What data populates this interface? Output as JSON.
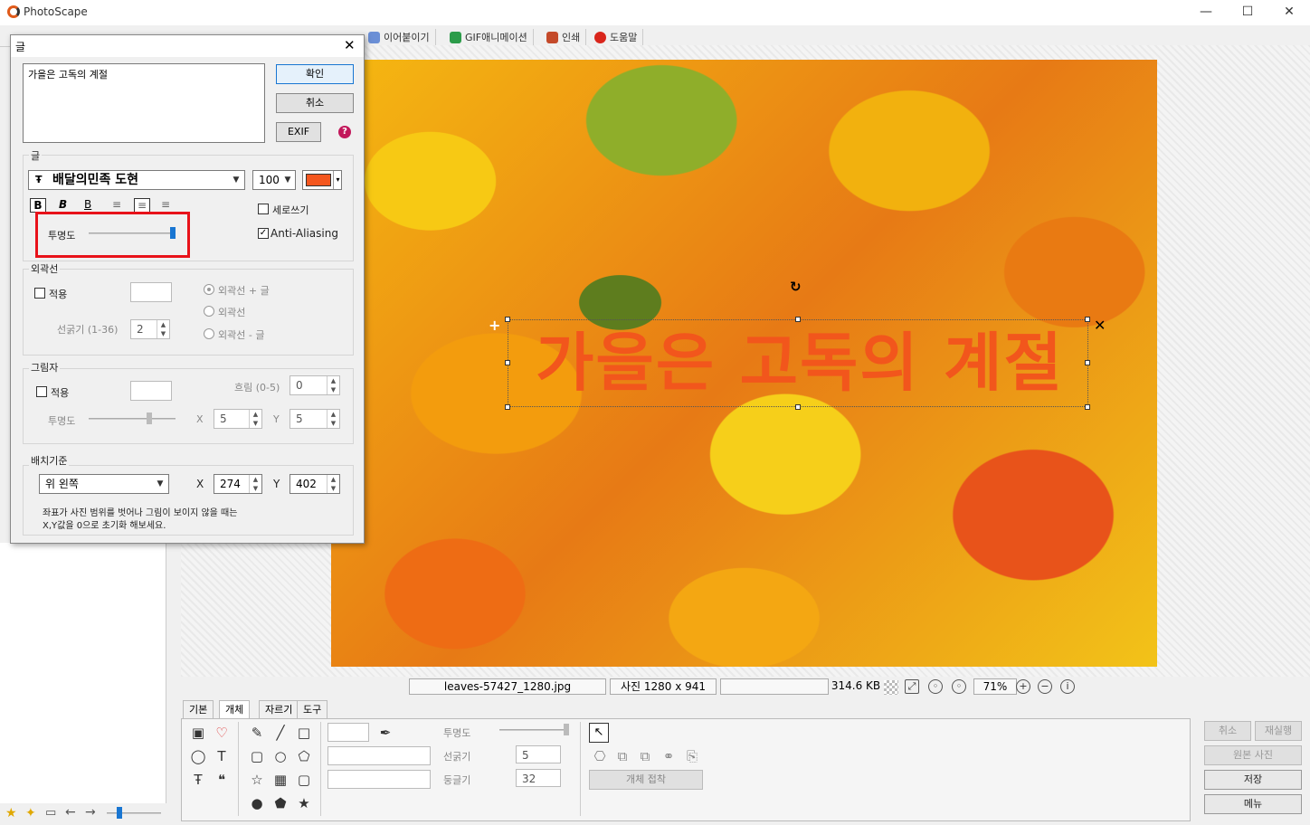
{
  "app": {
    "title": "PhotoScape"
  },
  "window_controls": {
    "minimize": "—",
    "maximize": "☐",
    "close": "✕"
  },
  "tabs": [
    {
      "label": "이어붙이기"
    },
    {
      "label": "GIF애니메이션"
    },
    {
      "label": "인쇄"
    },
    {
      "label": "도움말"
    }
  ],
  "photo": {
    "text_overlay": "가을은 고독의 계절",
    "accent": "#f2561c"
  },
  "status": {
    "filename": "leaves-57427_1280.jpg",
    "dimensions": "사진 1280 x 941",
    "filesize": "314.6 KB",
    "zoom": "71%"
  },
  "bottom_tabs": [
    {
      "label": "기본"
    },
    {
      "label": "개체"
    },
    {
      "label": "자르기"
    },
    {
      "label": "도구"
    }
  ],
  "bottom_panel": {
    "opacity_label": "투명도",
    "thickness_label": "선굵기",
    "thickness_value": "5",
    "roundness_label": "둥글기",
    "roundness_value": "32",
    "attach_button": "개체 접착"
  },
  "right_buttons": {
    "undo": "취소",
    "redo": "재실행",
    "original": "원본 사진",
    "save": "저장",
    "menu": "메뉴"
  },
  "dialog": {
    "title": "글",
    "text_value": "가을은 고독의 계절",
    "ok": "확인",
    "cancel": "취소",
    "exif": "EXIF",
    "help_icon": "?",
    "font_group": "글",
    "font_name": "배달의민족 도현",
    "font_size": "100",
    "font_color": "#f4571f",
    "vertical_label": "세로쓰기",
    "antialias_label": "Anti-Aliasing",
    "antialias_checked": true,
    "vertical_checked": false,
    "opacity_label": "투명도",
    "opacity_level": 1.0,
    "outline_group": "외곽선",
    "outline_apply": "적용",
    "outline_thickness_label": "선굵기 (1-36)",
    "outline_thickness_value": "2",
    "outline_opt1": "외곽선 + 글",
    "outline_opt2": "외곽선",
    "outline_opt3": "외곽선 - 글",
    "shadow_group": "그림자",
    "shadow_apply": "적용",
    "shadow_blur_label": "흐림 (0-5)",
    "shadow_blur_value": "0",
    "shadow_opacity_label": "투명도",
    "shadow_x_label": "X",
    "shadow_x_value": "5",
    "shadow_y_label": "Y",
    "shadow_y_value": "5",
    "placement_group": "배치기준",
    "placement_value": "위 왼쪽",
    "pos_x_label": "X",
    "pos_x_value": "274",
    "pos_y_label": "Y",
    "pos_y_value": "402",
    "note_line1": "좌표가 사진 범위를 벗어나 그림이 보이지 않을 때는",
    "note_line2": "X,Y값을 0으로 초기화 해보세요."
  }
}
